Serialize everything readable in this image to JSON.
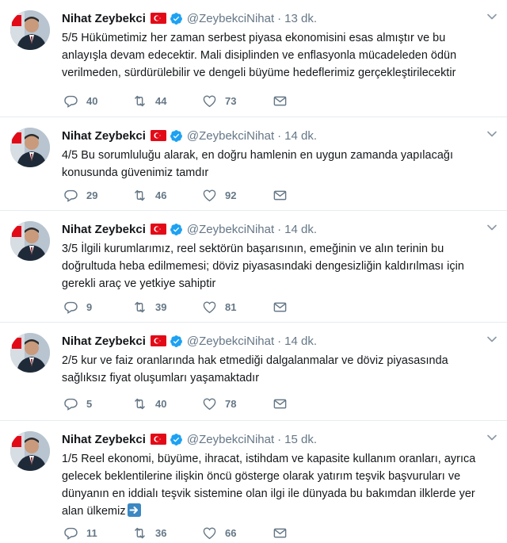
{
  "colors": {
    "text": "#14171a",
    "secondary": "#657786",
    "divider": "#e6ecf0",
    "verified": "#1da1f2",
    "flag_red": "#e30a17"
  },
  "icons": {
    "reply": "reply-icon",
    "retweet": "retweet-icon",
    "like": "heart-icon",
    "message": "envelope-icon",
    "more": "chevron-down-icon",
    "verified": "verified-badge-icon",
    "flag": "turkey-flag-icon",
    "emoji": "right-arrow-emoji"
  },
  "tweets": [
    {
      "name": "Nihat Zeybekci",
      "handle": "@ZeybekciNihat",
      "dot": "·",
      "time": "13 dk.",
      "text": "5/5 Hükümetimiz her zaman serbest piyasa ekonomisini esas almıştır ve bu anlayışla devam edecektir. Mali disiplinden ve enflasyonla mücadeleden ödün verilmeden, sürdürülebilir ve dengeli büyüme hedeflerimiz gerçekleştirilecektir",
      "replies": "40",
      "retweets": "44",
      "likes": "73"
    },
    {
      "name": "Nihat Zeybekci",
      "handle": "@ZeybekciNihat",
      "dot": "·",
      "time": "14 dk.",
      "text": "4/5 Bu sorumluluğu alarak, en doğru hamlenin en uygun zamanda yapılacağı konusunda güvenimiz tamdır",
      "replies": "29",
      "retweets": "46",
      "likes": "92"
    },
    {
      "name": "Nihat Zeybekci",
      "handle": "@ZeybekciNihat",
      "dot": "·",
      "time": "14 dk.",
      "text": "3/5 İlgili kurumlarımız, reel sektörün başarısının, emeğinin ve alın terinin bu doğrultuda heba edilmemesi; döviz piyasasındaki dengesizliğin kaldırılması için gerekli araç ve yetkiye sahiptir",
      "replies": "9",
      "retweets": "39",
      "likes": "81"
    },
    {
      "name": "Nihat Zeybekci",
      "handle": "@ZeybekciNihat",
      "dot": "·",
      "time": "14 dk.",
      "text": "2/5 kur ve faiz oranlarında hak etmediği dalgalanmalar ve döviz piyasasında sağlıksız fiyat oluşumları yaşamaktadır",
      "replies": "5",
      "retweets": "40",
      "likes": "78"
    },
    {
      "name": "Nihat Zeybekci",
      "handle": "@ZeybekciNihat",
      "dot": "·",
      "time": "15 dk.",
      "text": "1/5 Reel ekonomi, büyüme, ihracat, istihdam ve kapasite kullanım oranları, ayrıca gelecek beklentilerine ilişkin öncü gösterge olarak yatırım teşvik başvuruları ve dünyanın en iddialı teşvik sistemine olan ilgi ile dünyada bu bakımdan ilklerde yer alan ülkemiz",
      "replies": "11",
      "retweets": "36",
      "likes": "66"
    }
  ]
}
